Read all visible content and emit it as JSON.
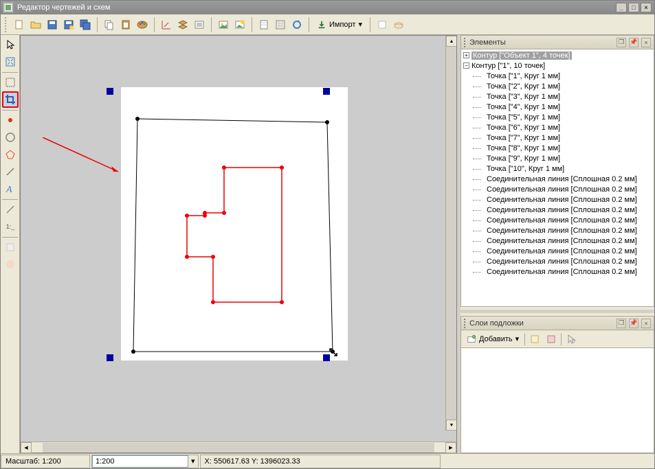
{
  "window": {
    "title": "Редактор чертежей и схем"
  },
  "toolbar": {
    "import_label": "Импорт"
  },
  "panels": {
    "elements": {
      "title": "Элементы",
      "root1": "Контур [\"Объект 1\", 4 точек]",
      "root2": "Контур [\"1\", 10 точек]",
      "points": [
        "Точка [\"1\", Круг 1 мм]",
        "Точка [\"2\", Круг 1 мм]",
        "Точка [\"3\", Круг 1 мм]",
        "Точка [\"4\", Круг 1 мм]",
        "Точка [\"5\", Круг 1 мм]",
        "Точка [\"6\", Круг 1 мм]",
        "Точка [\"7\", Круг 1 мм]",
        "Точка [\"8\", Круг 1 мм]",
        "Точка [\"9\", Круг 1 мм]",
        "Точка [\"10\", Круг 1 мм]"
      ],
      "lines": [
        "Соединительная линия [Сплошная 0.2 мм]",
        "Соединительная линия [Сплошная 0.2 мм]",
        "Соединительная линия [Сплошная 0.2 мм]",
        "Соединительная линия [Сплошная 0.2 мм]",
        "Соединительная линия [Сплошная 0.2 мм]",
        "Соединительная линия [Сплошная 0.2 мм]",
        "Соединительная линия [Сплошная 0.2 мм]",
        "Соединительная линия [Сплошная 0.2 мм]",
        "Соединительная линия [Сплошная 0.2 мм]",
        "Соединительная линия [Сплошная 0.2 мм]"
      ]
    },
    "layers": {
      "title": "Слои подложки",
      "add_label": "Добавить"
    }
  },
  "status": {
    "scale_label": "Масштаб: 1:200",
    "scale_value": "1:200",
    "coords": "X: 550617.63 Y: 1396023.33"
  }
}
